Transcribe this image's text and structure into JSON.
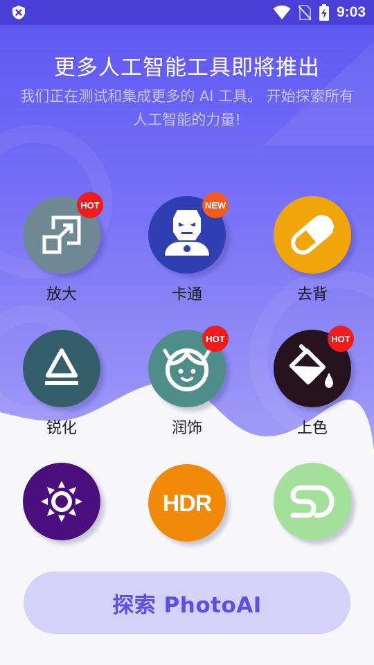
{
  "status_bar": {
    "time": "9:03"
  },
  "header": {
    "title": "更多人工智能工具即將推出",
    "subtitle": "我们正在测试和集成更多的 AI 工具。 开始探索所有人工智能的力量!"
  },
  "tools": [
    {
      "label": "放大",
      "icon": "upscale-icon",
      "color": "#6e8894",
      "badge": "HOT",
      "badge_color": "#ef1c1c"
    },
    {
      "label": "卡通",
      "icon": "ironman-icon",
      "color": "#2d3fb3",
      "badge": "NEW",
      "badge_color": "#f45a1f"
    },
    {
      "label": "去背",
      "icon": "eraser-icon",
      "color": "#f0a60a",
      "badge": "",
      "badge_color": ""
    },
    {
      "label": "锐化",
      "icon": "sharpen-triangle-icon",
      "color": "#355e6b",
      "badge": "",
      "badge_color": ""
    },
    {
      "label": "润饰",
      "icon": "face-icon",
      "color": "#4f8e88",
      "badge": "HOT",
      "badge_color": "#ef1c1c"
    },
    {
      "label": "上色",
      "icon": "paint-bucket-icon",
      "color": "#25121c",
      "badge": "HOT",
      "badge_color": "#ef1c1c"
    },
    {
      "label": "",
      "icon": "brightness-icon",
      "color": "#4a0f7c",
      "badge": "",
      "badge_color": ""
    },
    {
      "label": "",
      "icon": "hdr-icon",
      "color": "#f28a09",
      "badge": "",
      "badge_color": "",
      "text": "HDR"
    },
    {
      "label": "",
      "icon": "sd-icon",
      "color": "#a3e09a",
      "badge": "",
      "badge_color": ""
    }
  ],
  "explore_button": {
    "label": "探索 PhotoAI"
  }
}
